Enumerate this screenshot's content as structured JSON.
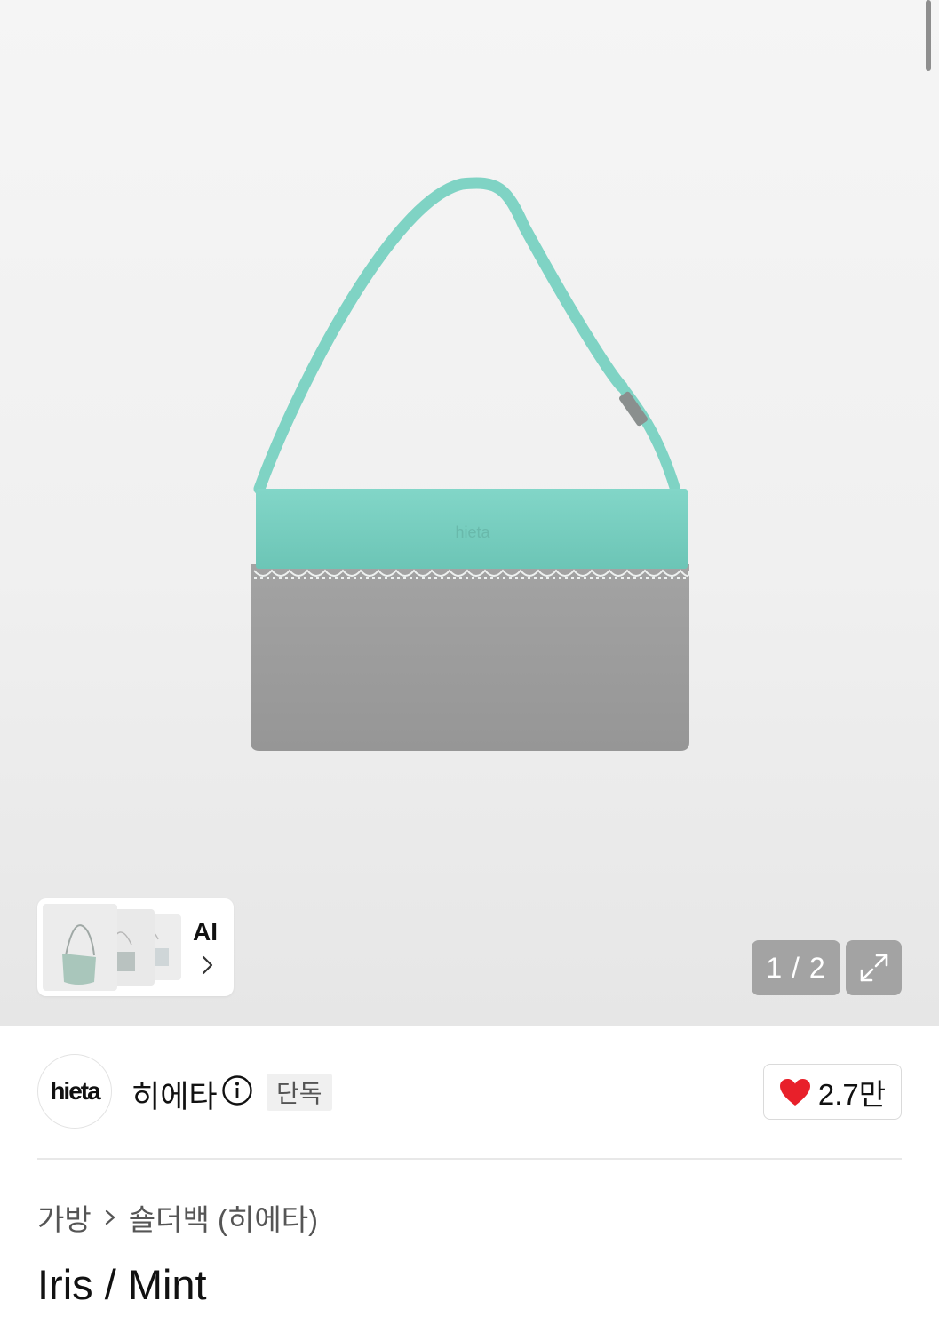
{
  "gallery": {
    "ai_label": "AI",
    "pager_text": "1 / 2",
    "current_page": 1,
    "total_pages": 2,
    "icons": {
      "ai_arrow": "chevron-right-icon",
      "expand": "expand-icon"
    },
    "colors": {
      "bag_mint": "#79cfc1",
      "bag_felt": "#9a9a9a"
    }
  },
  "brand": {
    "logo_text": "hieta",
    "name": "히에타",
    "badge": "단독",
    "info_icon": "info-icon"
  },
  "likes": {
    "count": "2.7만",
    "icon": "heart-icon",
    "color": "#e8202a"
  },
  "breadcrumb": {
    "items": [
      "가방",
      "숄더백 (히에타)"
    ]
  },
  "product": {
    "title": "Iris / Mint"
  }
}
